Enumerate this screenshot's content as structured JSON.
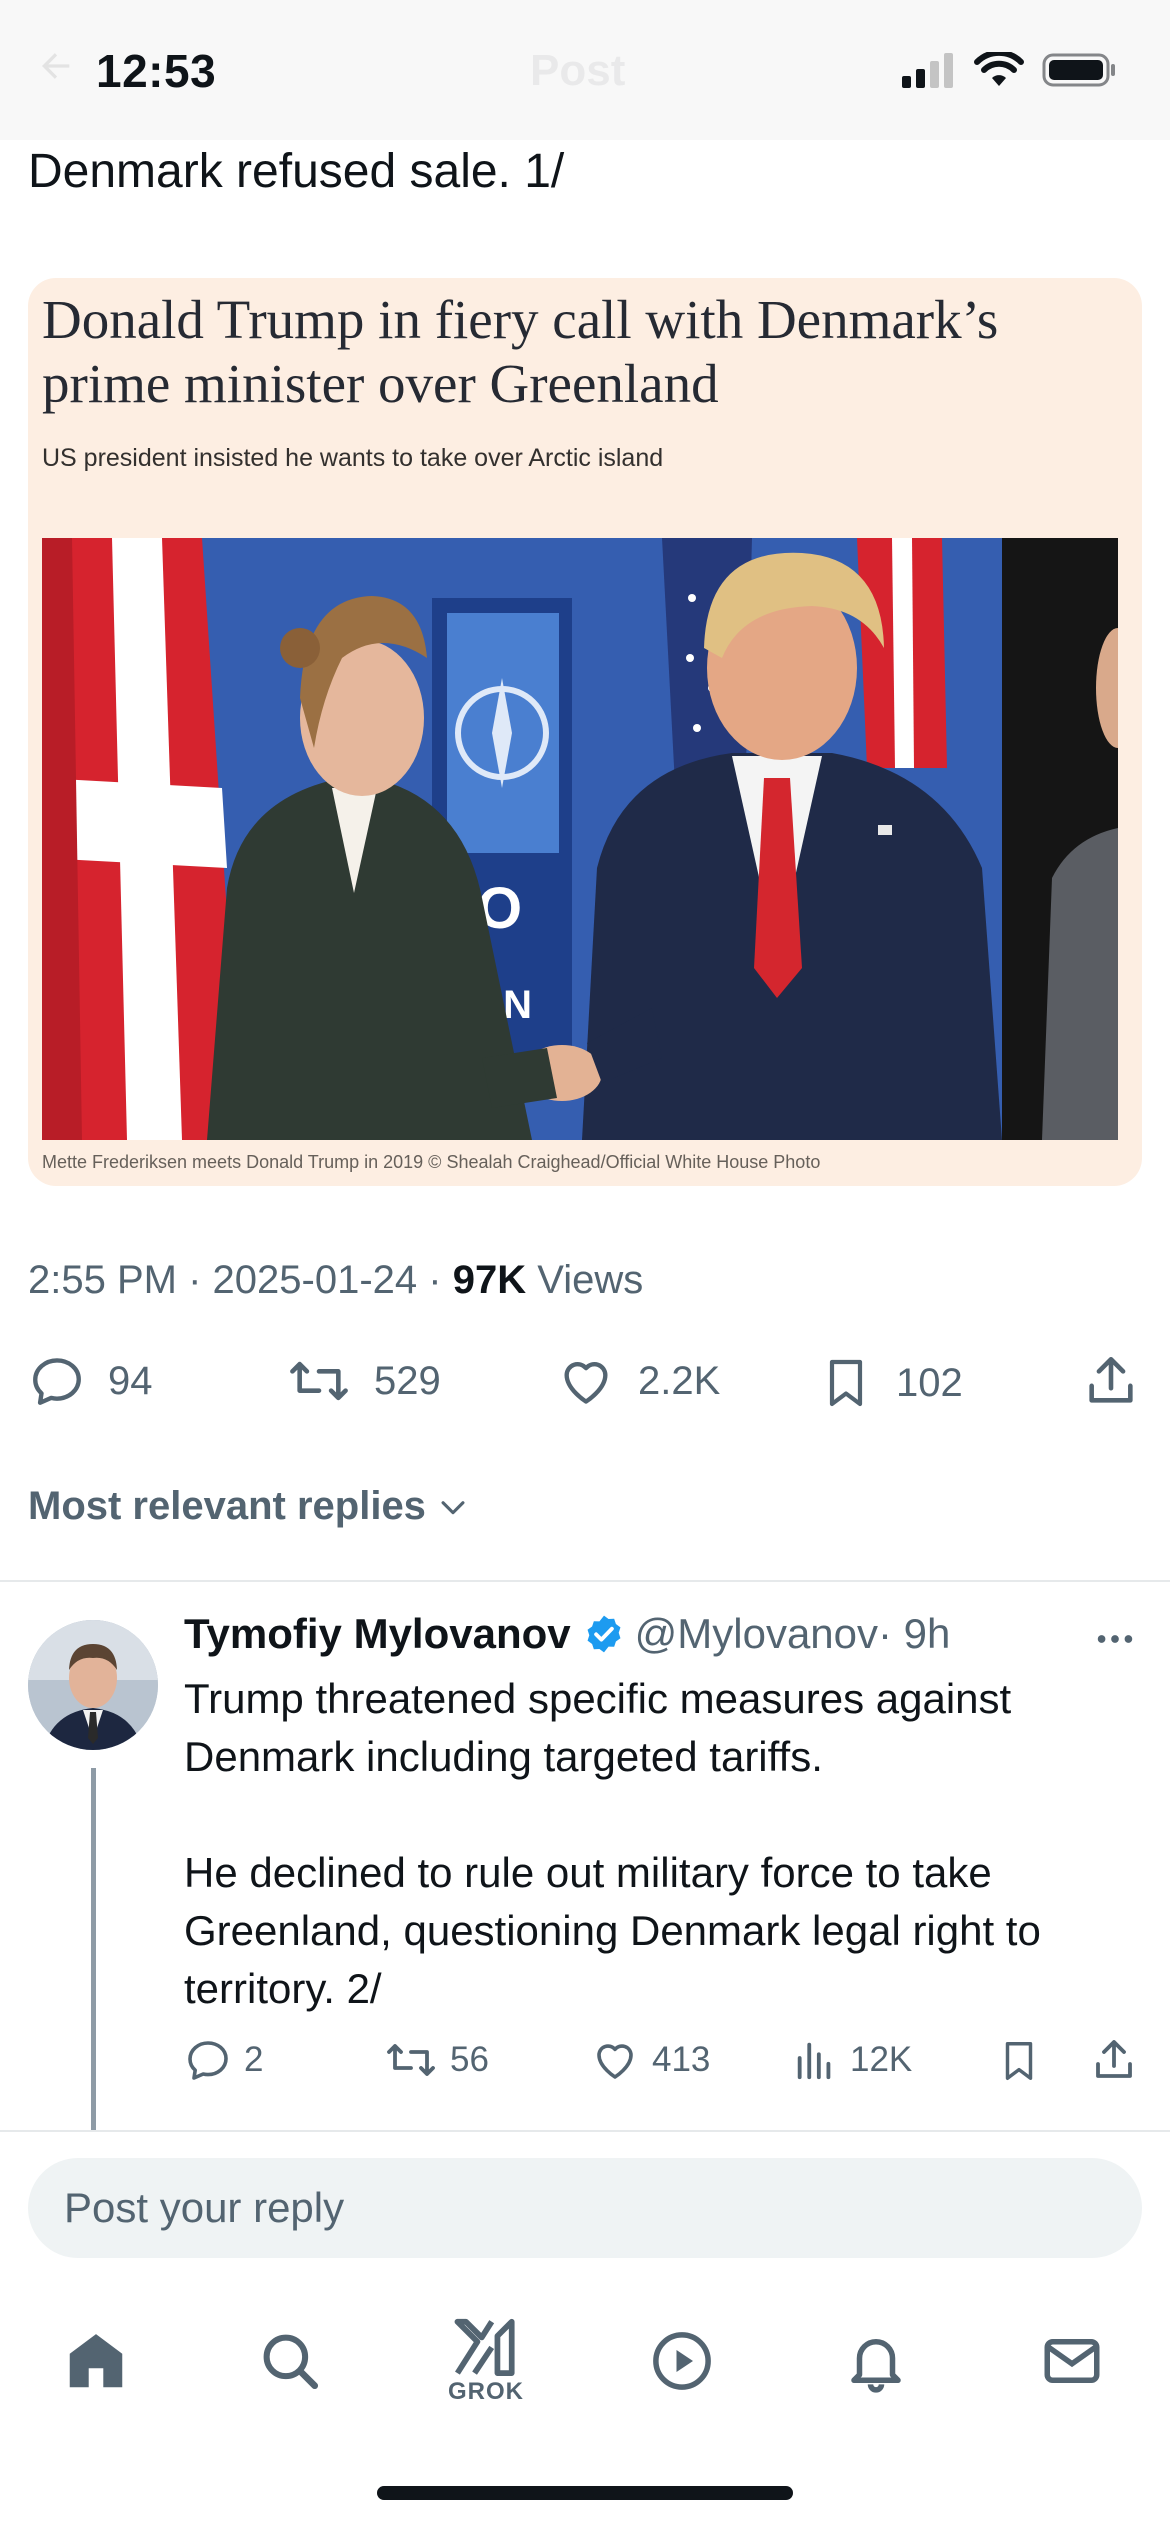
{
  "status_bar": {
    "time": "12:53",
    "nav_title": "Post"
  },
  "tweet": {
    "text": "Denmark refused sale. 1/",
    "article": {
      "headline": "Donald Trump in fiery call with Denmark’s prime minister over Greenland",
      "subheadline": "US president insisted he wants to take over Arctic island",
      "photo_caption": "Mette Frederiksen meets Donald Trump in 2019 © Shealah Craighead/Official White House Photo",
      "photo_text_partial": [
        "O",
        "ON"
      ]
    },
    "meta": {
      "time": "2:55 PM",
      "date": "2025-01-24",
      "views_count": "97K",
      "views_label": "Views",
      "sep": "·"
    },
    "actions": {
      "replies": "94",
      "reposts": "529",
      "likes": "2.2K",
      "bookmarks": "102"
    }
  },
  "replies_sort": {
    "label": "Most relevant replies"
  },
  "reply": {
    "name": "Tymofiy Mylovanov",
    "handle": "@Mylovanov",
    "time": "· 9h",
    "text": "Trump threatened specific measures against Denmark including targeted tariffs.\n\nHe declined to rule out military force to take Greenland, questioning Denmark legal right to territory. 2/",
    "actions": {
      "replies": "2",
      "reposts": "56",
      "likes": "413",
      "views": "12K"
    }
  },
  "composer": {
    "placeholder": "Post your reply"
  },
  "tab_bar": {
    "grok_label": "GROK"
  },
  "colors": {
    "text": "#0f1419",
    "secondary": "#536471",
    "verified": "#1d9bf0",
    "card_bg": "#fdeee2"
  }
}
